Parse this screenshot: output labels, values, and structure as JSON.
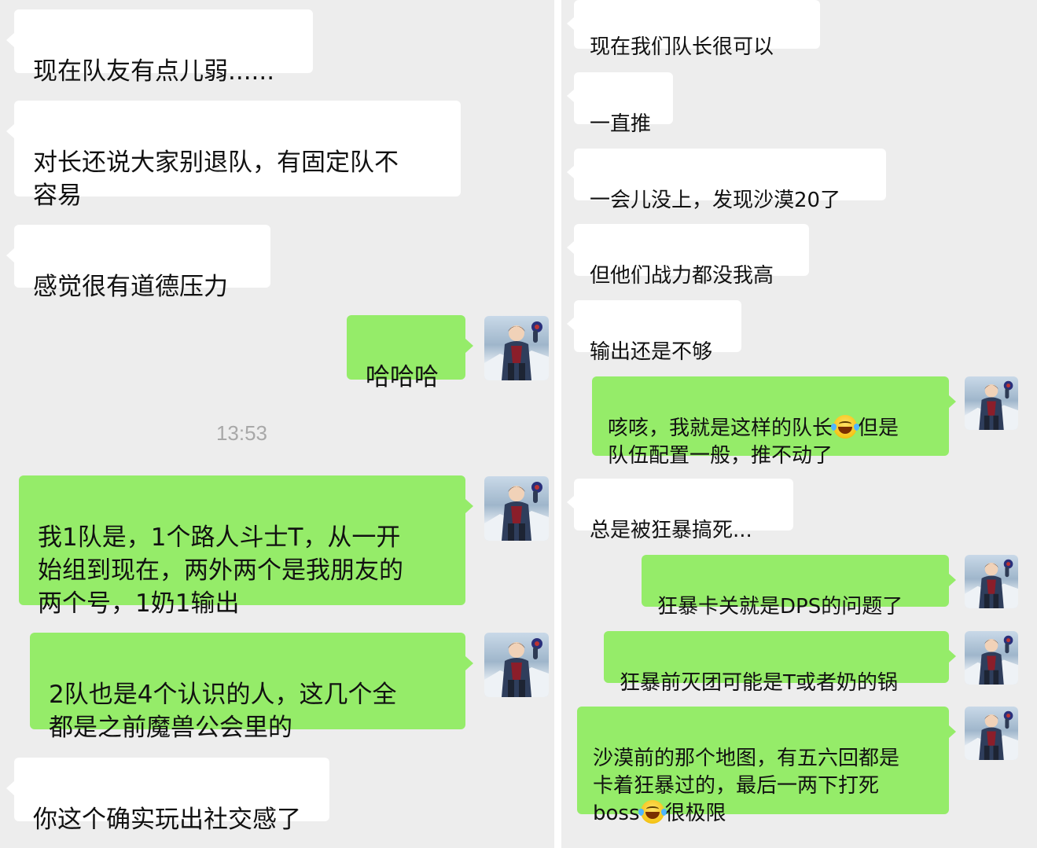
{
  "left_panel": {
    "messages": [
      {
        "side": "received",
        "text": "现在队友有点儿弱......"
      },
      {
        "side": "received",
        "text": "对长还说大家别退队，有固定队不\n容易"
      },
      {
        "side": "received",
        "text": "感觉很有道德压力"
      },
      {
        "side": "sent",
        "text": "哈哈哈"
      },
      {
        "side": "sent",
        "text": "我1队是，1个路人斗士T，从一开\n始组到现在，两外两个是我朋友的\n两个号，1奶1输出"
      },
      {
        "side": "sent",
        "text": "2队也是4个认识的人，这几个全\n都是之前魔兽公会里的"
      },
      {
        "side": "received",
        "text": "你这个确实玩出社交感了"
      }
    ],
    "timestamp": "13:53"
  },
  "right_panel": {
    "messages": [
      {
        "side": "received",
        "text": "现在我们队长很可以"
      },
      {
        "side": "received",
        "text": "一直推"
      },
      {
        "side": "received",
        "text": "一会儿没上，发现沙漠20了"
      },
      {
        "side": "received",
        "text": "但他们战力都没我高"
      },
      {
        "side": "received",
        "text": "输出还是不够"
      },
      {
        "side": "sent",
        "text_a": "咳咳，我就是这样的队长",
        "emoji": "tears-of-joy",
        "text_b": "但是\n队伍配置一般，推不动了"
      },
      {
        "side": "received",
        "text": "总是被狂暴搞死..."
      },
      {
        "side": "sent",
        "text": "狂暴卡关就是DPS的问题了"
      },
      {
        "side": "sent",
        "text": "狂暴前灭团可能是T或者奶的锅"
      },
      {
        "side": "sent",
        "text_a": "沙漠前的那个地图，有五六回都是\n卡着狂暴过的，最后一两下打死\nboss",
        "emoji": "tears-of-joy",
        "text_b": "很极限"
      }
    ]
  },
  "colors": {
    "panel_bg": "#ededed",
    "received_bubble": "#ffffff",
    "sent_bubble": "#95ec69",
    "timestamp": "#a8a8a8"
  },
  "icons": {
    "avatar": "anime-character-avatar-icon",
    "emoji": "tears-of-joy-emoji-icon"
  }
}
